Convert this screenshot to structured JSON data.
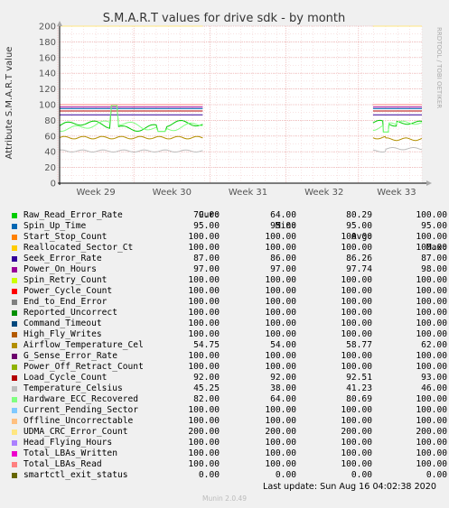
{
  "chart_data": {
    "type": "line",
    "title": "S.M.A.R.T values for drive sdk - by month",
    "ylabel": "Attribute S.M.A.R.T value",
    "ylim": [
      0,
      200
    ],
    "yticks": [
      0,
      20,
      40,
      60,
      80,
      100,
      120,
      140,
      160,
      180,
      200
    ],
    "xticks": [
      "Week 29",
      "Week 30",
      "Week 31",
      "Week 32",
      "Week 33"
    ],
    "grid": true,
    "side_label": "RRDTOOL / TOBI OETIKER",
    "columns": [
      "Cur:",
      "Min:",
      "Avg:",
      "Max:"
    ],
    "series": [
      {
        "name": "Raw_Read_Error_Rate",
        "color": "#00cc00",
        "cur": "79.00",
        "min": "64.00",
        "avg": "80.29",
        "max": "100.00"
      },
      {
        "name": "Spin_Up_Time",
        "color": "#0066b3",
        "cur": "95.00",
        "min": "95.00",
        "avg": "95.00",
        "max": "95.00"
      },
      {
        "name": "Start_Stop_Count",
        "color": "#ff8000",
        "cur": "100.00",
        "min": "100.00",
        "avg": "100.00",
        "max": "100.00"
      },
      {
        "name": "Reallocated_Sector_Ct",
        "color": "#ffcc00",
        "cur": "100.00",
        "min": "100.00",
        "avg": "100.00",
        "max": "100.00"
      },
      {
        "name": "Seek_Error_Rate",
        "color": "#330099",
        "cur": "87.00",
        "min": "86.00",
        "avg": "86.26",
        "max": "87.00"
      },
      {
        "name": "Power_On_Hours",
        "color": "#990099",
        "cur": "97.00",
        "min": "97.00",
        "avg": "97.74",
        "max": "98.00"
      },
      {
        "name": "Spin_Retry_Count",
        "color": "#ccff00",
        "cur": "100.00",
        "min": "100.00",
        "avg": "100.00",
        "max": "100.00"
      },
      {
        "name": "Power_Cycle_Count",
        "color": "#ff0000",
        "cur": "100.00",
        "min": "100.00",
        "avg": "100.00",
        "max": "100.00"
      },
      {
        "name": "End_to_End_Error",
        "color": "#808080",
        "cur": "100.00",
        "min": "100.00",
        "avg": "100.00",
        "max": "100.00"
      },
      {
        "name": "Reported_Uncorrect",
        "color": "#008f00",
        "cur": "100.00",
        "min": "100.00",
        "avg": "100.00",
        "max": "100.00"
      },
      {
        "name": "Command_Timeout",
        "color": "#00487d",
        "cur": "100.00",
        "min": "100.00",
        "avg": "100.00",
        "max": "100.00"
      },
      {
        "name": "High_Fly_Writes",
        "color": "#b35a00",
        "cur": "100.00",
        "min": "100.00",
        "avg": "100.00",
        "max": "100.00"
      },
      {
        "name": "Airflow_Temperature_Cel",
        "color": "#b38f00",
        "cur": "54.75",
        "min": "54.00",
        "avg": "58.77",
        "max": "62.00"
      },
      {
        "name": "G_Sense_Error_Rate",
        "color": "#6b006b",
        "cur": "100.00",
        "min": "100.00",
        "avg": "100.00",
        "max": "100.00"
      },
      {
        "name": "Power_Off_Retract_Count",
        "color": "#8fb300",
        "cur": "100.00",
        "min": "100.00",
        "avg": "100.00",
        "max": "100.00"
      },
      {
        "name": "Load_Cycle_Count",
        "color": "#b30000",
        "cur": "92.00",
        "min": "92.00",
        "avg": "92.51",
        "max": "93.00"
      },
      {
        "name": "Temperature_Celsius",
        "color": "#bebebe",
        "cur": "45.25",
        "min": "38.00",
        "avg": "41.23",
        "max": "46.00"
      },
      {
        "name": "Hardware_ECC_Recovered",
        "color": "#80ff80",
        "cur": "82.00",
        "min": "64.00",
        "avg": "80.69",
        "max": "100.00"
      },
      {
        "name": "Current_Pending_Sector",
        "color": "#80c9ff",
        "cur": "100.00",
        "min": "100.00",
        "avg": "100.00",
        "max": "100.00"
      },
      {
        "name": "Offline_Uncorrectable",
        "color": "#ffc080",
        "cur": "100.00",
        "min": "100.00",
        "avg": "100.00",
        "max": "100.00"
      },
      {
        "name": "UDMA_CRC_Error_Count",
        "color": "#ffe680",
        "cur": "200.00",
        "min": "200.00",
        "avg": "200.00",
        "max": "200.00"
      },
      {
        "name": "Head_Flying_Hours",
        "color": "#aa80ff",
        "cur": "100.00",
        "min": "100.00",
        "avg": "100.00",
        "max": "100.00"
      },
      {
        "name": "Total_LBAs_Written",
        "color": "#ee00cc",
        "cur": "100.00",
        "min": "100.00",
        "avg": "100.00",
        "max": "100.00"
      },
      {
        "name": "Total_LBAs_Read",
        "color": "#ff8080",
        "cur": "100.00",
        "min": "100.00",
        "avg": "100.00",
        "max": "100.00"
      },
      {
        "name": "smartctl_exit_status",
        "color": "#666600",
        "cur": "0.00",
        "min": "0.00",
        "avg": "0.00",
        "max": "0.00"
      }
    ]
  },
  "footer": {
    "last_update": "Last update: Sun Aug 16 04:02:38 2020",
    "munin": "Munin 2.0.49"
  }
}
